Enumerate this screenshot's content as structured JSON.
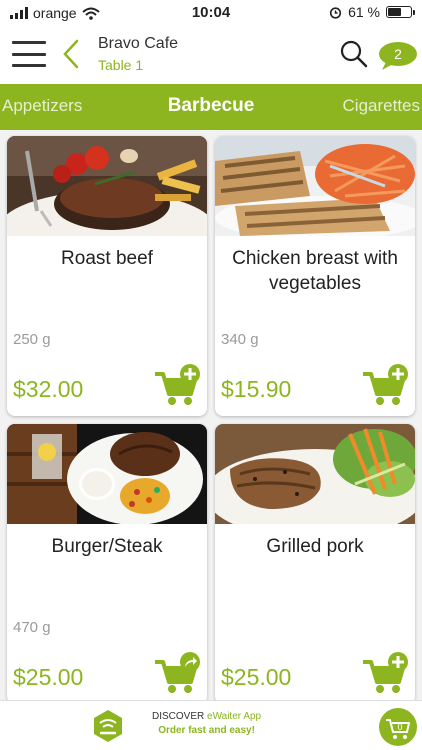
{
  "status_bar": {
    "carrier": "orange",
    "time": "10:04",
    "battery": "61 %",
    "battery_level": 0.61
  },
  "header": {
    "cafe_name": "Bravo Cafe",
    "table": "Table 1",
    "cart_count": "2"
  },
  "categories": {
    "left": "Appetizers",
    "active": "Barbecue",
    "right": "Cigarettes"
  },
  "items": [
    {
      "name": "Roast beef",
      "weight": "250 g",
      "price": "$32.00",
      "action_icon": "add-to-cart-icon"
    },
    {
      "name": "Chicken breast with vegetables",
      "weight": "340 g",
      "price": "$15.90",
      "action_icon": "add-to-cart-icon"
    },
    {
      "name": "Burger/Steak",
      "weight": "470 g",
      "price": "$25.00",
      "action_icon": "go-to-options-cart-icon"
    },
    {
      "name": "Grilled pork",
      "weight": "",
      "price": "$25.00",
      "action_icon": "add-to-cart-icon"
    }
  ],
  "footer": {
    "discover": "DISCOVER",
    "app_name": "eWaiter App",
    "tagline": "Order fast and easy!",
    "cart_count": "0"
  },
  "colors": {
    "accent": "#8cb520",
    "text": "#222222",
    "muted": "#9a9a9a"
  }
}
